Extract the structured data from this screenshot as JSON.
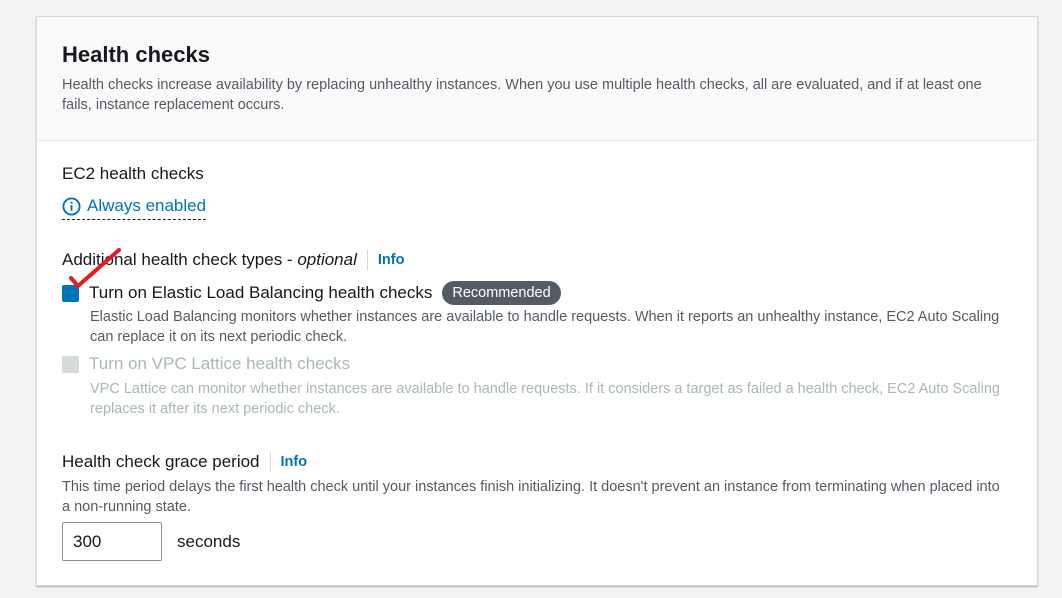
{
  "panel": {
    "title": "Health checks",
    "description": "Health checks increase availability by replacing unhealthy instances. When you use multiple health checks, all are evaluated, and if at least one fails, instance replacement occurs."
  },
  "ec2": {
    "label": "EC2 health checks",
    "status_icon": "info-circle-icon",
    "status": "Always enabled"
  },
  "additional": {
    "label": "Additional health check types - ",
    "optional": "optional",
    "info": "Info",
    "options": [
      {
        "label": "Turn on Elastic Load Balancing health checks",
        "checked": true,
        "disabled": false,
        "badge": "Recommended",
        "description": "Elastic Load Balancing monitors whether instances are available to handle requests. When it reports an unhealthy instance, EC2 Auto Scaling can replace it on its next periodic check."
      },
      {
        "label": "Turn on VPC Lattice health checks",
        "checked": false,
        "disabled": true,
        "description": "VPC Lattice can monitor whether instances are available to handle requests. If it considers a target as failed a health check, EC2 Auto Scaling replaces it after its next periodic check."
      }
    ]
  },
  "grace_period": {
    "label": "Health check grace period",
    "info": "Info",
    "description": "This time period delays the first health check until your instances finish initializing. It doesn't prevent an instance from terminating when placed into a non-running state.",
    "value": "300",
    "unit": "seconds"
  },
  "colors": {
    "link": "#0073bb",
    "badge_bg": "#545b64",
    "annotation": "#e31b23"
  }
}
